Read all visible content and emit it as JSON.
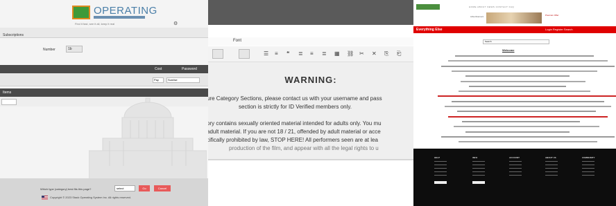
{
  "panel1": {
    "logo_text": "OPERATING",
    "tagline": "Find it fast, see it all, keep it real",
    "topbar_label": "Subscriptions",
    "field_label": "Number",
    "select_value": "1b",
    "header_col1": "Cost",
    "header_col2": "Password",
    "row_input1": "Pay",
    "row_input2": "Sunrise",
    "section2_label": "Items",
    "footer_text": "Which type (category) best fits this page?",
    "footer_select": "select",
    "footer_btn1": "Go",
    "footer_btn2": "Cancel",
    "copyright": "Copyright © 2023 Stack Operating System Inc. All rights reserved."
  },
  "panel2": {
    "font_select": "Font",
    "warning_title": "WARNING:",
    "lines": [
      "ure Category Sections, please contact us with your username and pass",
      "section is strictly for ID Verified members only.",
      "",
      "ory contains sexually oriented material intended for adults only. You mu",
      "adult material. If you are not 18 / 21, offended by adult material or acce",
      "cifically prohibited by law, STOP HERE! All performers seen are at lea",
      "production of the film, and appear with all the legal rights to u"
    ]
  },
  "panel3": {
    "nav_items": "HOME   ABOUT   NEWS   CONTACT   FAQ",
    "ad_text": "Advertisement",
    "ad_side": "Premium Offer",
    "redbar_title": "Everything Else",
    "redbar_right": "Login   Register   Search",
    "search_placeholder": "Search",
    "heading": "Welcome",
    "footer_cols": [
      "HELP",
      "INFO",
      "ACCOUNT",
      "ABOUT US",
      "COMMUNITY"
    ]
  },
  "colors": {
    "accent_green": "#3e9a3a",
    "accent_red": "#e00000",
    "dark_bar": "#4a4a4a"
  }
}
